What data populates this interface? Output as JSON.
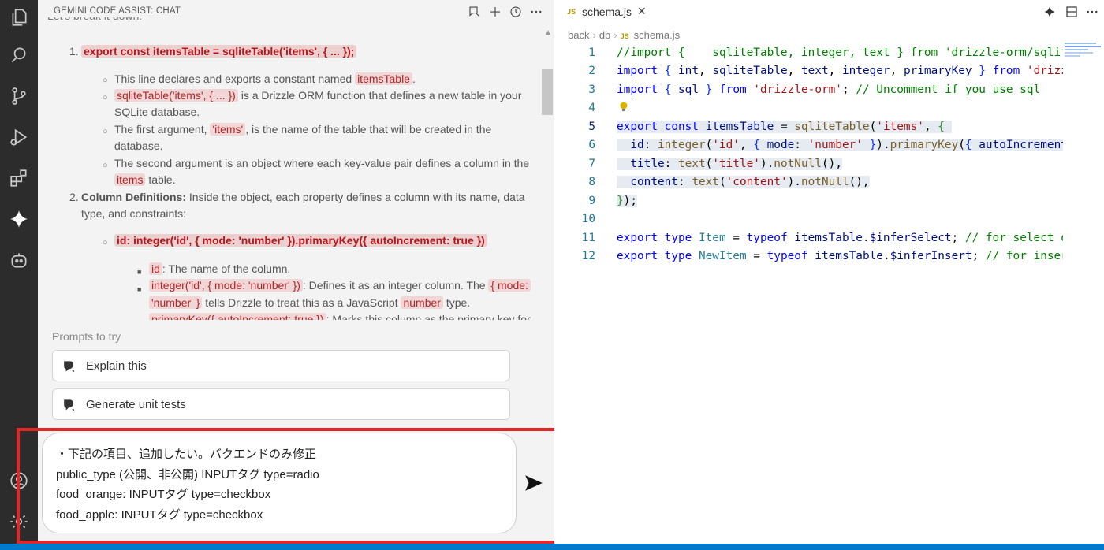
{
  "chat": {
    "title": "GEMINI CODE ASSIST: CHAT",
    "intro": "Let's break it down:",
    "item1_num": "1.",
    "item1_code": "export const itemsTable = sqliteTable('items', { ... });",
    "b1_pre": "This line declares and exports a constant named ",
    "b1_code": "itemsTable",
    "b1_post": ".",
    "b2_code": "sqliteTable('items', { ... })",
    "b2_post": " is a Drizzle ORM function that defines a new table in your",
    "b2_line2": "SQLite database.",
    "b3_pre": "The first argument, ",
    "b3_code": "'items'",
    "b3_post": ", is the name of the table that will be created in the",
    "b3_line2": "database.",
    "b4_line1": "The second argument is an object where each key-value pair defines a column in the",
    "b4_code": "items",
    "b4_post": " table.",
    "item2_num": "2.",
    "item2_bold": "Column Definitions:",
    "item2_text": " Inside the object, each property defines a column with its name, data",
    "item2_line2": "type, and constraints:",
    "sub_code": "id: integer('id', { mode: 'number' }).primaryKey({ autoIncrement: true })",
    "s1_code": "id",
    "s1_post": ": The name of the column.",
    "s2_code": "integer('id', { mode: 'number' })",
    "s2_post": ": Defines it as an integer column. The ",
    "s2_code2": "{ mode:",
    "s2_code3": "'number' }",
    "s2_post2": " tells Drizzle to treat this as a JavaScript ",
    "s2_code4": "number",
    "s2_post3": " type.",
    "s3_code": "primaryKey({ autoIncrement: true })",
    "s3_post": ": Marks this column as the primary key for"
  },
  "prompts": {
    "label": "Prompts to try",
    "items": [
      "Explain this",
      "Generate unit tests"
    ]
  },
  "input": {
    "text": "・下記の項目、追加したい。バクエンドのみ修正\npublic_type (公開、非公開) INPUTタグ type=radio\nfood_orange: INPUTタグ type=checkbox\nfood_apple: INPUTタグ type=checkbox"
  },
  "editor": {
    "tab_badge": "JS",
    "tab_name": "schema.js",
    "breadcrumb": [
      "back",
      "db",
      "schema.js"
    ],
    "line_numbers": [
      "1",
      "2",
      "3",
      "4",
      "5",
      "6",
      "7",
      "8",
      "9",
      "10",
      "11",
      "12"
    ]
  },
  "colors": {
    "accent": "#007acc",
    "highlight_border": "#e32626",
    "activity_bar": "#2c2c2c"
  },
  "icons": [
    "explorer-icon",
    "search-icon",
    "source-control-icon",
    "run-debug-icon",
    "extensions-icon",
    "gemini-icon",
    "bot-icon",
    "account-icon",
    "settings-icon",
    "new-chat-icon",
    "add-icon",
    "history-icon",
    "more-icon",
    "sparkle-icon",
    "split-editor-icon",
    "lightbulb-icon",
    "send-icon"
  ]
}
